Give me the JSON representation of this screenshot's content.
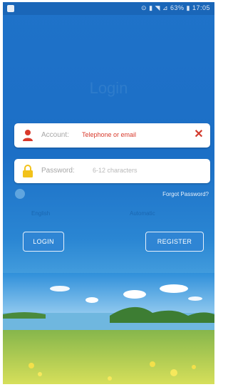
{
  "status_bar": {
    "text": "⊙ ▮ ◥ ⊿ 63% ▮ 17:05"
  },
  "screen": {
    "title": "Login"
  },
  "account_field": {
    "label": "Account:",
    "placeholder": "Telephone or email"
  },
  "password_field": {
    "label": "Password:",
    "placeholder": "6-12 characters"
  },
  "forgot_password": "Forgot Password?",
  "options": {
    "left": "English",
    "right": "Automatic"
  },
  "buttons": {
    "login": "LOGIN",
    "register": "REGISTER"
  },
  "colors": {
    "accent_red": "#d83a2c",
    "lock_yellow": "#f2c21b",
    "background_blue": "#1f72c9"
  },
  "icons": [
    "user-icon",
    "lock-icon",
    "close-icon",
    "radio-icon"
  ]
}
